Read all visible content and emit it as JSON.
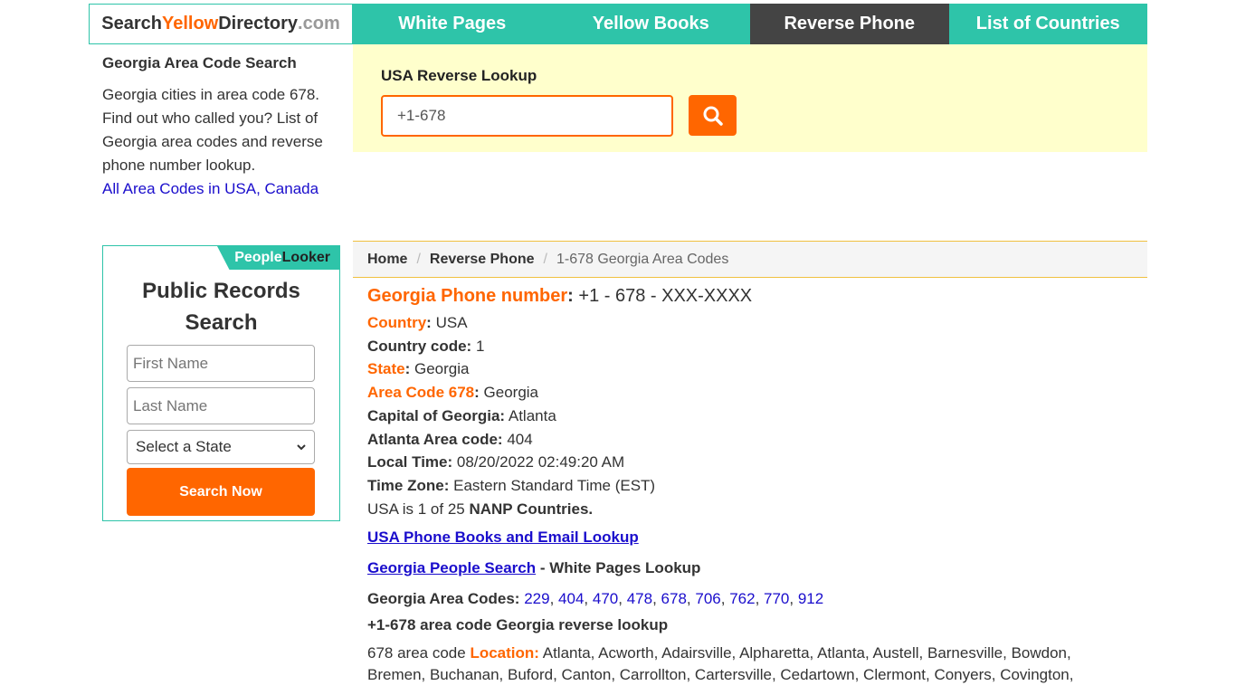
{
  "logo": {
    "part1": "Search",
    "part2": "Yellow",
    "part3": "Directory",
    "part4": ".com"
  },
  "nav": [
    {
      "label": "White Pages",
      "active": false
    },
    {
      "label": "Yellow Books",
      "active": false
    },
    {
      "label": "Reverse Phone",
      "active": true
    },
    {
      "label": "List of Countries",
      "active": false
    }
  ],
  "left": {
    "heading": "Georgia Area Code Search",
    "description": "Georgia cities in area code 678. Find out who called you? List of Georgia area codes and reverse phone number lookup.",
    "link": "All Area Codes in USA, Canada"
  },
  "search": {
    "title": "USA Reverse Lookup",
    "value": "+1-678",
    "button_icon": "search-icon"
  },
  "widget": {
    "brand_a": "People",
    "brand_b": "Looker",
    "title": "Public Records Search",
    "first_placeholder": "First Name",
    "last_placeholder": "Last Name",
    "state_selected": "Select a State",
    "button": "Search Now"
  },
  "breadcrumb": {
    "home": "Home",
    "section": "Reverse Phone",
    "current": "1-678 Georgia Area Codes"
  },
  "main": {
    "heading_label": "Georgia Phone number",
    "heading_value": "+1 - 678 - XXX-XXXX",
    "country_label": "Country",
    "country_value": "USA",
    "country_code_label": "Country code:",
    "country_code_value": "1",
    "state_label": "State",
    "state_value": "Georgia",
    "area_label": "Area Code 678",
    "area_value": "Georgia",
    "capital_label": "Capital of Georgia:",
    "capital_value": "Atlanta",
    "atl_label": "Atlanta Area code:",
    "atl_value": "404",
    "time_label": "Local Time:",
    "time_value": "08/20/2022 02:49:20 AM",
    "tz_label": "Time Zone:",
    "tz_value": "Eastern Standard Time (EST)",
    "nanp_prefix": "USA is 1 of 25",
    "nanp_link": "NANP Countries",
    "phonebooks_link": "USA Phone Books and Email Lookup",
    "people_link": "Georgia People Search",
    "people_suffix": " - White Pages Lookup",
    "codes_label": "Georgia Area Codes:",
    "codes": [
      "229",
      "404",
      "470",
      "478",
      "678",
      "706",
      "762",
      "770",
      "912"
    ],
    "reverse_heading": "+1-678 area code Georgia reverse lookup",
    "location_prefix": "678 area code",
    "location_label": "Location:",
    "location_text": "Atlanta, Acworth, Adairsville, Alpharetta, Atlanta, Austell, Barnesville, Bowdon, Bremen, Buchanan, Buford, Canton, Carrollton, Cartersville, Cedartown, Clermont, Conyers, Covington,"
  },
  "colors": {
    "teal": "#2ec4a9",
    "orange": "#ff6600",
    "dark": "#444444",
    "link": "#1a0dcc",
    "banner": "#ffffcc"
  }
}
